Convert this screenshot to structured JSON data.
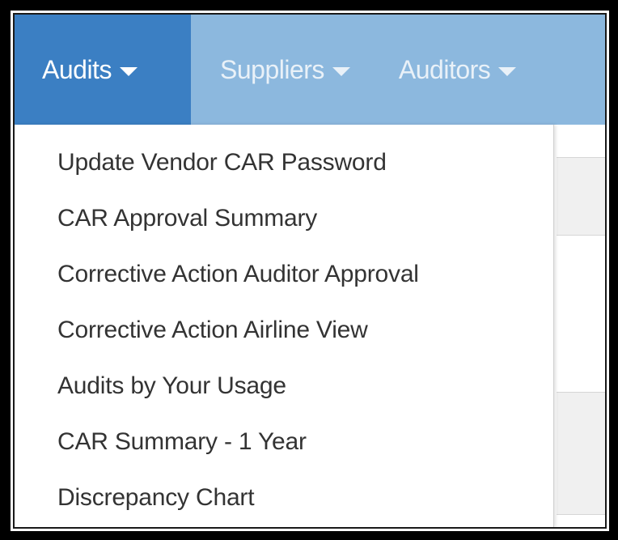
{
  "nav": {
    "items": [
      {
        "label": "Audits",
        "active": true
      },
      {
        "label": "Suppliers",
        "active": false
      },
      {
        "label": "Auditors",
        "active": false
      }
    ]
  },
  "audits_menu": {
    "items": [
      {
        "label": "Update Vendor CAR Password"
      },
      {
        "label": "CAR Approval Summary"
      },
      {
        "label": "Corrective Action Auditor Approval"
      },
      {
        "label": "Corrective Action Airline View"
      },
      {
        "label": "Audits by Your Usage"
      },
      {
        "label": "CAR Summary - 1 Year"
      },
      {
        "label": "Discrepancy Chart"
      }
    ]
  },
  "colors": {
    "navbar_bg": "#8cb8de",
    "active_tab_bg": "#3b7fc3",
    "menu_text": "#333333"
  }
}
